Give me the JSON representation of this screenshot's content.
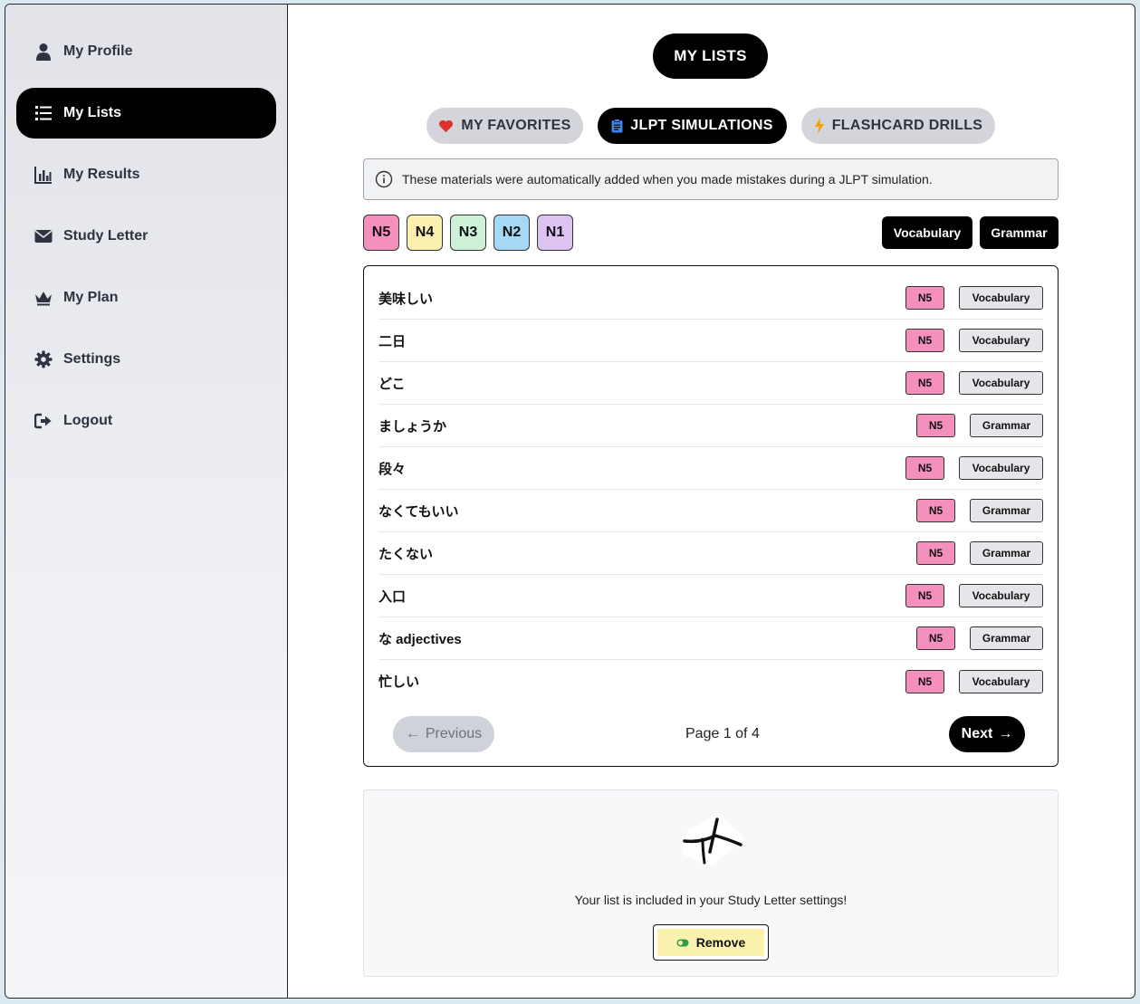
{
  "sidebar": {
    "items": [
      {
        "label": "My Profile",
        "icon": "user-icon"
      },
      {
        "label": "My Lists",
        "icon": "list-icon",
        "active": true
      },
      {
        "label": "My Results",
        "icon": "bar-chart-icon"
      },
      {
        "label": "Study Letter",
        "icon": "envelope-icon"
      },
      {
        "label": "My Plan",
        "icon": "crown-icon"
      },
      {
        "label": "Settings",
        "icon": "gear-icon"
      },
      {
        "label": "Logout",
        "icon": "logout-icon"
      }
    ]
  },
  "header": {
    "title": "MY LISTS"
  },
  "tabs": [
    {
      "label": "MY FAVORITES",
      "icon": "heart-icon",
      "color": "#e03131"
    },
    {
      "label": "JLPT SIMULATIONS",
      "icon": "clipboard-icon",
      "color": "#3b82f6",
      "active": true
    },
    {
      "label": "FLASHCARD DRILLS",
      "icon": "lightning-icon",
      "color": "#f59f00"
    }
  ],
  "info": {
    "text": "These materials were automatically added when you made mistakes during a JLPT simulation."
  },
  "filters": {
    "levels": [
      {
        "label": "N5",
        "color": "#f590bd"
      },
      {
        "label": "N4",
        "color": "#fbf0b0"
      },
      {
        "label": "N3",
        "color": "#cdf0d6"
      },
      {
        "label": "N2",
        "color": "#a5d8f5"
      },
      {
        "label": "N1",
        "color": "#dcc4f2"
      }
    ],
    "types": [
      "Vocabulary",
      "Grammar"
    ]
  },
  "list": {
    "items": [
      {
        "word": "美味しい",
        "level": "N5",
        "type": "Vocabulary"
      },
      {
        "word": "二日",
        "level": "N5",
        "type": "Vocabulary"
      },
      {
        "word": "どこ",
        "level": "N5",
        "type": "Vocabulary"
      },
      {
        "word": "ましょうか",
        "level": "N5",
        "type": "Grammar"
      },
      {
        "word": "段々",
        "level": "N5",
        "type": "Vocabulary"
      },
      {
        "word": "なくてもいい",
        "level": "N5",
        "type": "Grammar"
      },
      {
        "word": "たくない",
        "level": "N5",
        "type": "Grammar"
      },
      {
        "word": "入口",
        "level": "N5",
        "type": "Vocabulary"
      },
      {
        "word": "な adjectives",
        "level": "N5",
        "type": "Grammar"
      },
      {
        "word": "忙しい",
        "level": "N5",
        "type": "Vocabulary"
      }
    ]
  },
  "pagination": {
    "prev": "Previous",
    "page": "Page 1 of 4",
    "next": "Next"
  },
  "study_letter": {
    "text": "Your list is included in your Study Letter settings!",
    "button": "Remove"
  }
}
